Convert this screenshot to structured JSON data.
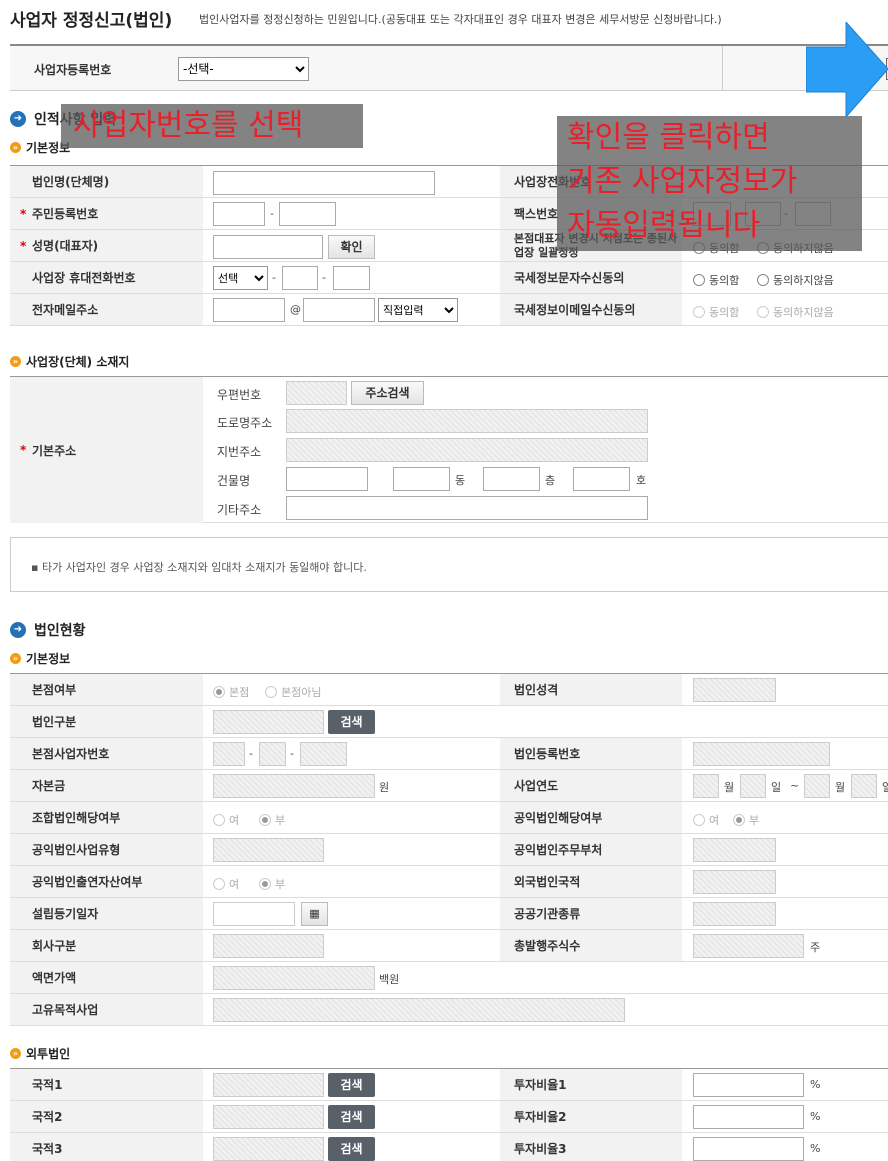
{
  "header": {
    "title": "사업자 정정신고(법인)",
    "description": "법인사업자를 정정신청하는 민원입니다.(공동대표 또는 각자대표인 경우 대표자 변경은 세무서방문 신청바랍니다.)"
  },
  "selector": {
    "label": "사업자등록번호",
    "selected": "-선택-"
  },
  "section1": {
    "title": "인적사항 입력",
    "basic_title": "기본정보",
    "rows": {
      "corp_name": "법인명(단체명)",
      "resident_no": "주민등록번호",
      "rep_name": "성명(대표자)",
      "confirm_btn": "확인",
      "mobile": "사업장 휴대전화번호",
      "mobile_select": "선택",
      "email": "전자메일주소",
      "email_at": "@",
      "email_domain": "직접입력",
      "biz_phone": "사업장전화번호",
      "fax": "팩스번호",
      "branch_change": "본점대표자 변경시 지점포는 종된사업장 일괄정정",
      "nts_sms": "국세정보문자수신동의",
      "nts_email": "국세정보이메일수신동의",
      "agree": "동의함",
      "disagree": "동의하지않음"
    },
    "addr_title": "사업장(단체) 소재지",
    "addr": {
      "label": "기본주소",
      "zip": "우편번호",
      "zip_btn": "주소검색",
      "road": "도로명주소",
      "lot": "지번주소",
      "building": "건물명",
      "dong": "동",
      "floor": "층",
      "ho": "호",
      "etc": "기타주소"
    },
    "notice": "타가 사업자인 경우 사업장 소재지와 임대차 소재지가 동일해야 합니다."
  },
  "section2": {
    "title": "법인현황",
    "basic_title": "기본정보",
    "rows": {
      "head_office": "본점여부",
      "head_yes": "본점",
      "head_no": "본점아님",
      "corp_type": "법인구분",
      "search": "검색",
      "head_biz_no": "본점사업자번호",
      "capital": "자본금",
      "won": "원",
      "union": "조합법인해당여부",
      "yes": "여",
      "no": "부",
      "public_type": "공익법인사업유형",
      "public_invest": "공익법인출연자산여부",
      "est_date": "설립등기일자",
      "company_div": "회사구분",
      "face_value": "액면가액",
      "hundred_won": "백원",
      "unique_biz": "고유목적사업",
      "corp_nature": "법인성격",
      "corp_reg_no": "법인등록번호",
      "biz_year": "사업연도",
      "month": "월",
      "day": "일",
      "tilde": "~",
      "public_flag": "공익법인해당여부",
      "public_ministry": "공익법인주무부처",
      "foreign_nat": "외국법인국적",
      "public_agency": "공공기관종류",
      "total_shares": "총발행주식수",
      "share_unit": "주"
    },
    "foreign_title": "외투법인",
    "foreign": [
      {
        "nat": "국적1",
        "ratio": "투자비율1"
      },
      {
        "nat": "국적2",
        "ratio": "투자비율2"
      },
      {
        "nat": "국적3",
        "ratio": "투자비율3"
      }
    ],
    "percent": "%"
  },
  "annotations": {
    "select_hint": "사업자번호를 선택",
    "confirm_hint_line1": "확인을 클릭하면",
    "confirm_hint_line2": "기존 사업자정보가",
    "confirm_hint_line3": "자동입력됩니다",
    "arrow_color": "#2a9df4",
    "text_color": "#e8202a"
  }
}
